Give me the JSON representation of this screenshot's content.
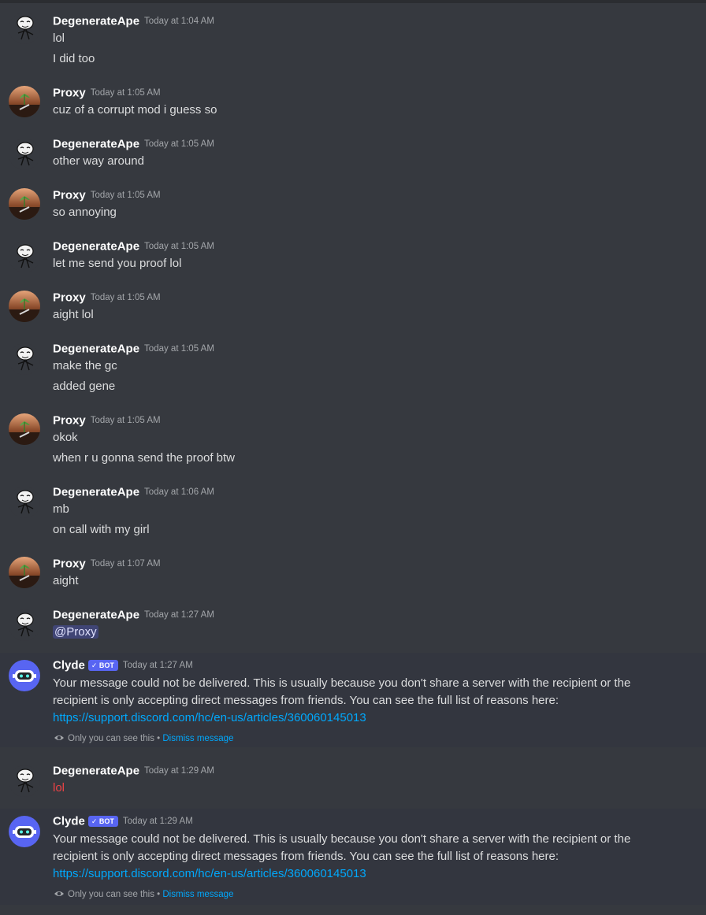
{
  "users": {
    "ape": "DegenerateApe",
    "proxy": "Proxy",
    "clyde": "Clyde"
  },
  "bot_badge": "✓ BOT",
  "mention": "@Proxy",
  "messages": [
    {
      "author": "DegenerateApe",
      "time": "Today at 1:04 AM",
      "lines": [
        "lol",
        "I did too"
      ]
    },
    {
      "author": "Proxy",
      "time": "Today at 1:05 AM",
      "lines": [
        "cuz of a corrupt mod i guess so"
      ]
    },
    {
      "author": "DegenerateApe",
      "time": "Today at 1:05 AM",
      "lines": [
        "other way around"
      ]
    },
    {
      "author": "Proxy",
      "time": "Today at 1:05 AM",
      "lines": [
        "so annoying"
      ]
    },
    {
      "author": "DegenerateApe",
      "time": "Today at 1:05 AM",
      "lines": [
        "let me send you proof lol"
      ]
    },
    {
      "author": "Proxy",
      "time": "Today at 1:05 AM",
      "lines": [
        "aight lol"
      ]
    },
    {
      "author": "DegenerateApe",
      "time": "Today at 1:05 AM",
      "lines": [
        "make the gc",
        "added gene"
      ]
    },
    {
      "author": "Proxy",
      "time": "Today at 1:05 AM",
      "lines": [
        "okok",
        "when r u gonna send the proof btw"
      ]
    },
    {
      "author": "DegenerateApe",
      "time": "Today at 1:06 AM",
      "lines": [
        "mb",
        "on call with my girl"
      ]
    },
    {
      "author": "Proxy",
      "time": "Today at 1:07 AM",
      "lines": [
        "aight"
      ]
    },
    {
      "author": "DegenerateApe",
      "time": "Today at 1:27 AM",
      "lines": [
        "@Proxy"
      ]
    },
    {
      "author": "Clyde",
      "time": "Today at 1:27 AM",
      "lines": [
        "Your message could not be delivered. This is usually because you don't share a server with the recipient or the",
        "recipient is only accepting direct messages from friends. You can see the full list of reasons here:",
        "https://support.discord.com/hc/en-us/articles/360060145013"
      ],
      "note": "Only you can see this •",
      "dismiss": "Dismiss message"
    },
    {
      "author": "DegenerateApe",
      "time": "Today at 1:29 AM",
      "lines": [
        "lol"
      ]
    },
    {
      "author": "Clyde",
      "time": "Today at 1:29 AM",
      "lines": [
        "Your message could not be delivered. This is usually because you don't share a server with the recipient or the",
        "recipient is only accepting direct messages from friends. You can see the full list of reasons here:",
        "https://support.discord.com/hc/en-us/articles/360060145013"
      ],
      "note": "Only you can see this •",
      "dismiss": "Dismiss message"
    }
  ],
  "colors": {
    "background": "#36393f",
    "ephemeral_background": "#33363f",
    "text": "#dcddde",
    "link": "#00a8fc",
    "error_text": "#ed4245",
    "bot_badge": "#5865f2"
  },
  "icons": [
    "ape-avatar-icon",
    "proxy-avatar-icon",
    "clyde-avatar-icon",
    "eye-icon"
  ]
}
